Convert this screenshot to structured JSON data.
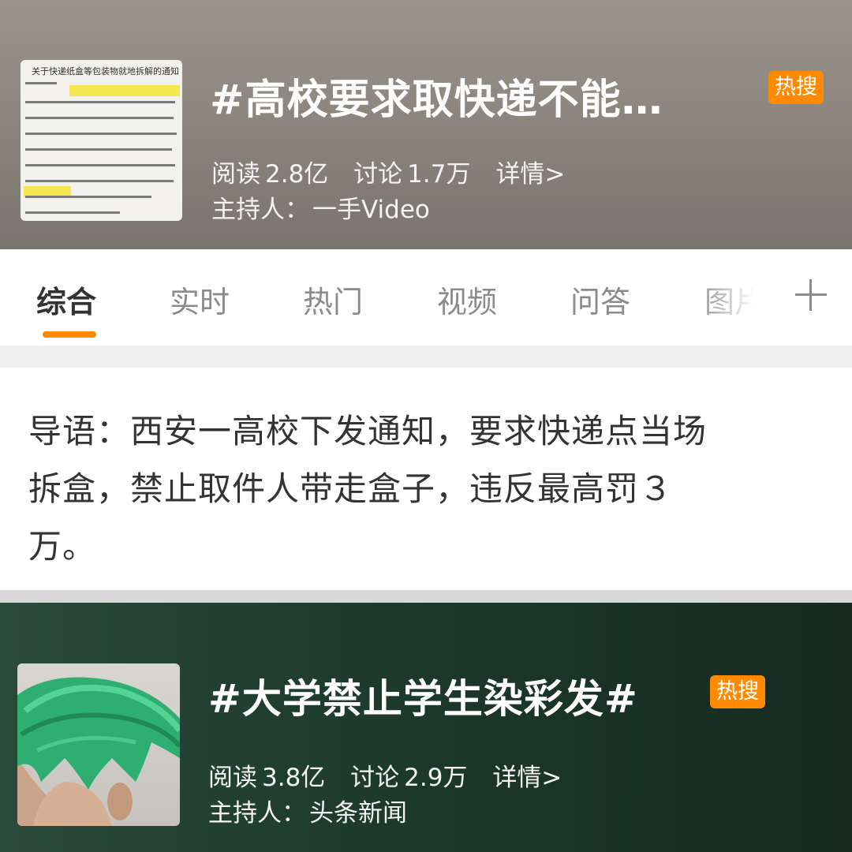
{
  "topic1": {
    "title": "#高校要求取快递不能…",
    "badge": "热搜",
    "reads_label": "阅读",
    "reads": "2.8亿",
    "discuss_label": "讨论",
    "discuss": "1.7万",
    "detail": "详情>",
    "host_label": "主持人：",
    "host": "一手Video",
    "thumb_doc_title": "关于快递纸盒等包装物就地拆解的通知"
  },
  "tabs": [
    {
      "label": "综合",
      "active": true
    },
    {
      "label": "实时",
      "active": false
    },
    {
      "label": "热门",
      "active": false
    },
    {
      "label": "视频",
      "active": false
    },
    {
      "label": "问答",
      "active": false
    },
    {
      "label": "图片",
      "active": false
    }
  ],
  "intro": {
    "line1": "导语：西安一高校下发通知，要求快递点当场",
    "line2": "拆盒，禁止取件人带走盒子，违反最高罚３",
    "line3": "万。"
  },
  "topic2": {
    "title": "#大学禁止学生染彩发#",
    "badge": "热搜",
    "reads_label": "阅读",
    "reads": "3.8亿",
    "discuss_label": "讨论",
    "discuss": "2.9万",
    "detail": "详情>",
    "host_label": "主持人：",
    "host": "头条新闻"
  },
  "colors": {
    "accent": "#ff8a00",
    "tab_inactive": "#8b8b8b",
    "text_dark": "#333333"
  }
}
